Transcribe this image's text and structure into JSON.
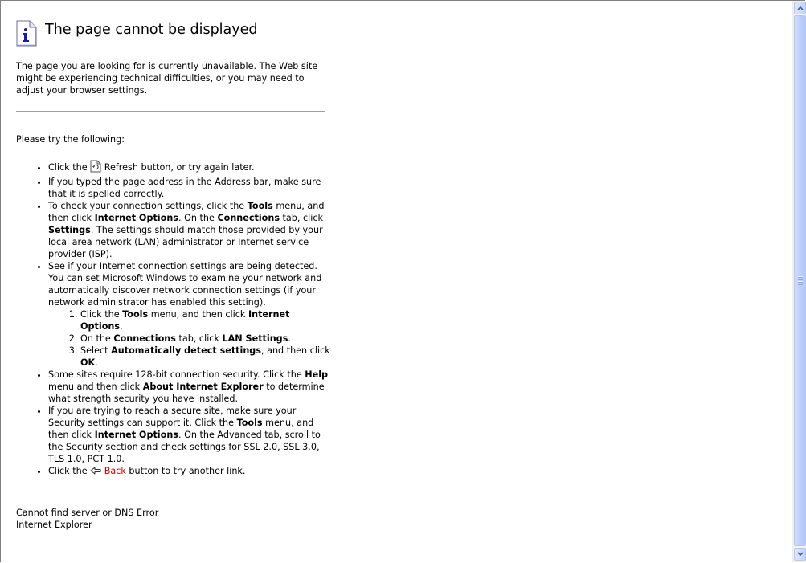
{
  "page": {
    "title": "The page cannot be displayed",
    "intro": "The page you are looking for is currently unavailable. The Web site might be experiencing technical difficulties, or you may need to adjust your browser settings.",
    "try_heading": "Please try the following:"
  },
  "tips": {
    "refresh": {
      "before": "Click the ",
      "after": " Refresh button, or try again later."
    },
    "address": "If you typed the page address in the Address bar, make sure that it is spelled correctly.",
    "connection": {
      "t1": "To check your connection settings, click the ",
      "b1": "Tools",
      "t2": " menu, and then click ",
      "b2": "Internet Options",
      "t3": ". On the ",
      "b3": "Connections",
      "t4": " tab, click ",
      "b4": "Settings",
      "t5": ". The settings should match those provided by your local area network (LAN) administrator or Internet service provider (ISP)."
    },
    "detect": {
      "text": "See if your Internet connection settings are being detected. You can set Microsoft Windows to examine your network and automatically discover network connection settings (if your network administrator has enabled this setting).",
      "step1": {
        "t1": "Click the ",
        "b1": "Tools",
        "t2": " menu, and then click ",
        "b2": "Internet Options",
        "t3": "."
      },
      "step2": {
        "t1": "On the ",
        "b1": "Connections",
        "t2": " tab, click ",
        "b2": "LAN Settings",
        "t3": "."
      },
      "step3": {
        "t1": "Select ",
        "b1": "Automatically detect settings",
        "t2": ", and then click ",
        "b2": "OK",
        "t3": "."
      }
    },
    "security128": {
      "t1": "Some sites require 128-bit connection security. Click the ",
      "b1": "Help",
      "t2": " menu and then click ",
      "b2": "About Internet Explorer",
      "t3": " to determine what strength security you have installed."
    },
    "secure_site": {
      "t1": "If you are trying to reach a secure site, make sure your Security settings can support it. Click the ",
      "b1": "Tools",
      "t2": " menu, and then click ",
      "b2": "Internet Options",
      "t3": ". On the Advanced tab, scroll to the Security section and check settings for SSL 2.0, SSL 3.0, TLS 1.0, PCT 1.0."
    },
    "back": {
      "before": "Click the ",
      "link": " Back",
      "after": " button to try another link."
    }
  },
  "footer": {
    "error": "Cannot find server or DNS Error",
    "browser": "Internet Explorer"
  },
  "colors": {
    "link": "#cc0000",
    "info_icon": "#1a1aa6"
  },
  "icons": {
    "title": "info-icon",
    "refresh": "refresh-icon",
    "back": "back-arrow-icon"
  }
}
